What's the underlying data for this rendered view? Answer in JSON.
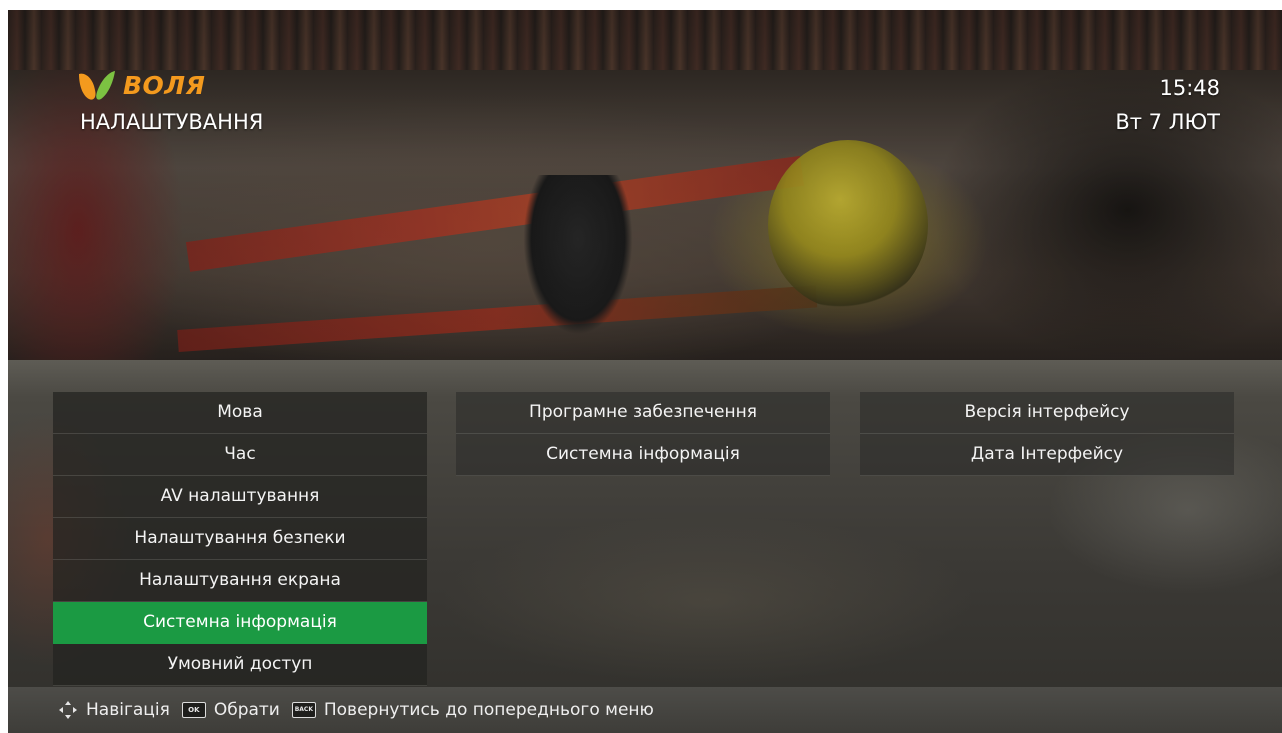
{
  "header": {
    "brand": "ВОЛЯ",
    "title": "НАЛАШТУВАННЯ",
    "time": "15:48",
    "date": "Вт 7 ЛЮТ"
  },
  "colors": {
    "accent": "#1b9a43",
    "brand_orange": "#f39a1e",
    "brand_green": "#7cc242"
  },
  "main_menu": {
    "items": [
      {
        "label": "Мова"
      },
      {
        "label": "Час"
      },
      {
        "label": "AV налаштування"
      },
      {
        "label": "Налаштування безпеки"
      },
      {
        "label": "Налаштування екрана"
      },
      {
        "label": "Системна інформація",
        "selected": true
      },
      {
        "label": "Умовний доступ"
      }
    ]
  },
  "sub_menu": {
    "items": [
      {
        "label": "Програмне забезпечення"
      },
      {
        "label": "Системна інформація"
      }
    ]
  },
  "info_menu": {
    "items": [
      {
        "label": "Версія інтерфейсу"
      },
      {
        "label": "Дата Інтерфейсу"
      }
    ]
  },
  "help": {
    "nav_label": "Навігація",
    "ok_key": "OK",
    "ok_label": "Обрати",
    "back_key": "BACK",
    "back_label": "Повернутись до попереднього меню",
    "nav_icon": "dpad-icon"
  }
}
